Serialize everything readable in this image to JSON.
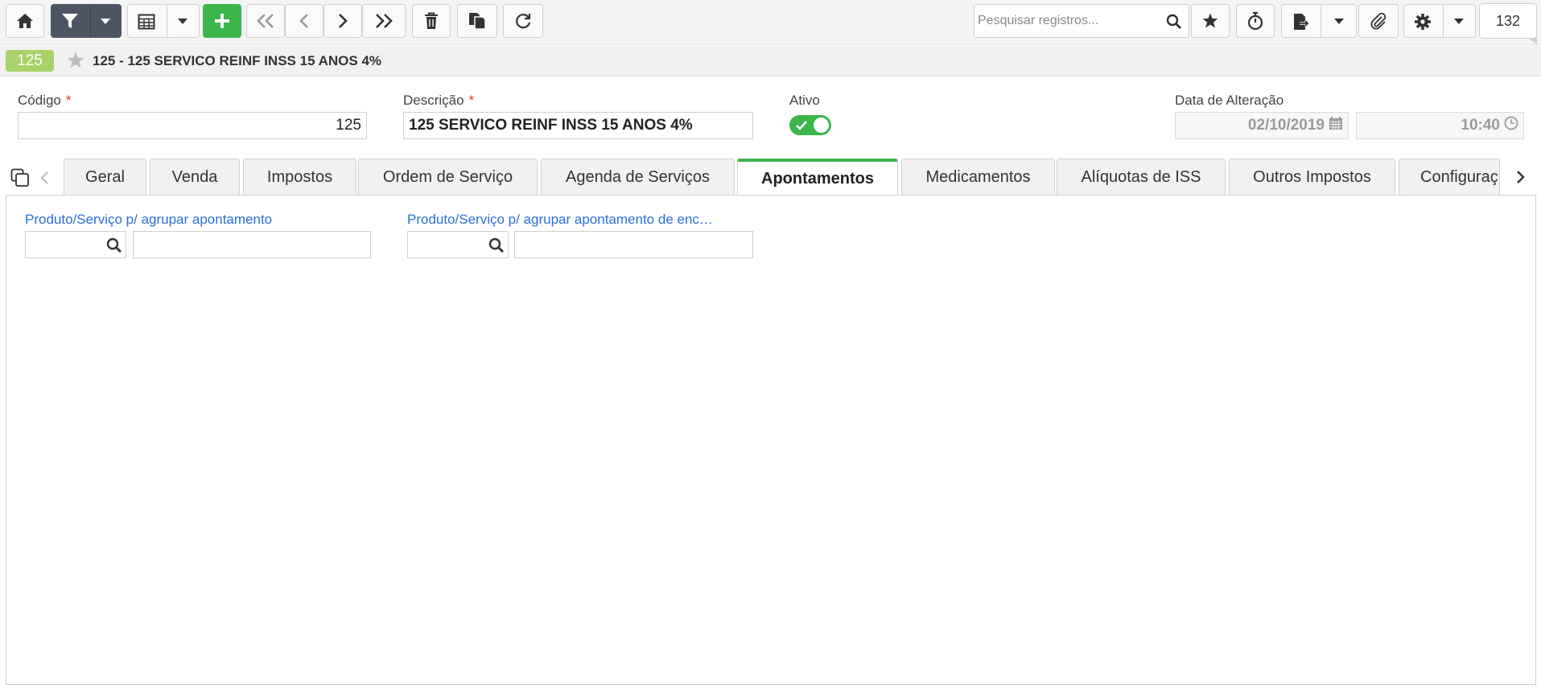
{
  "toolbar": {
    "search_placeholder": "Pesquisar registros...",
    "record_count": "132",
    "icons": [
      "home-icon",
      "filter-icon",
      "caret-down-icon",
      "table-icon",
      "caret-down-icon",
      "plus-icon",
      "double-chevron-left-icon",
      "chevron-left-icon",
      "chevron-right-icon",
      "double-chevron-right-icon",
      "trash-icon",
      "copy-icon",
      "refresh-icon",
      "search-icon",
      "star-icon",
      "stopwatch-icon",
      "export-icon",
      "caret-down-icon",
      "paperclip-icon",
      "gear-icon",
      "caret-down-icon"
    ],
    "colors": {
      "dark_button": "#4d5564",
      "green_button": "#3cb54a"
    }
  },
  "record": {
    "badge": "125",
    "title": "125 - 125 SERVICO REINF INSS 15 ANOS 4%",
    "badge_color": "#a8d36b"
  },
  "form": {
    "codigo_label": "Código",
    "codigo_value": "125",
    "descricao_label": "Descrição",
    "descricao_value": "125 SERVICO REINF INSS 15 ANOS 4%",
    "ativo_label": "Ativo",
    "ativo_value": true,
    "data_label": "Data de Alteração",
    "data_value": "02/10/2019",
    "hora_value": "10:40",
    "required_mark": "*"
  },
  "tabs": [
    {
      "label": "Geral"
    },
    {
      "label": "Venda"
    },
    {
      "label": "Impostos"
    },
    {
      "label": "Ordem de Serviço"
    },
    {
      "label": "Agenda de Serviços"
    },
    {
      "label": "Apontamentos",
      "active": true
    },
    {
      "label": "Medicamentos"
    },
    {
      "label": "Alíquotas de ISS"
    },
    {
      "label": "Outros Impostos"
    },
    {
      "label": "Configuraç"
    }
  ],
  "apontamentos": {
    "field1_label": "Produto/Serviço p/ agrupar apontamento",
    "field2_label": "Produto/Serviço p/ agrupar apontamento de enc…",
    "link_color": "#2a6fd6"
  }
}
